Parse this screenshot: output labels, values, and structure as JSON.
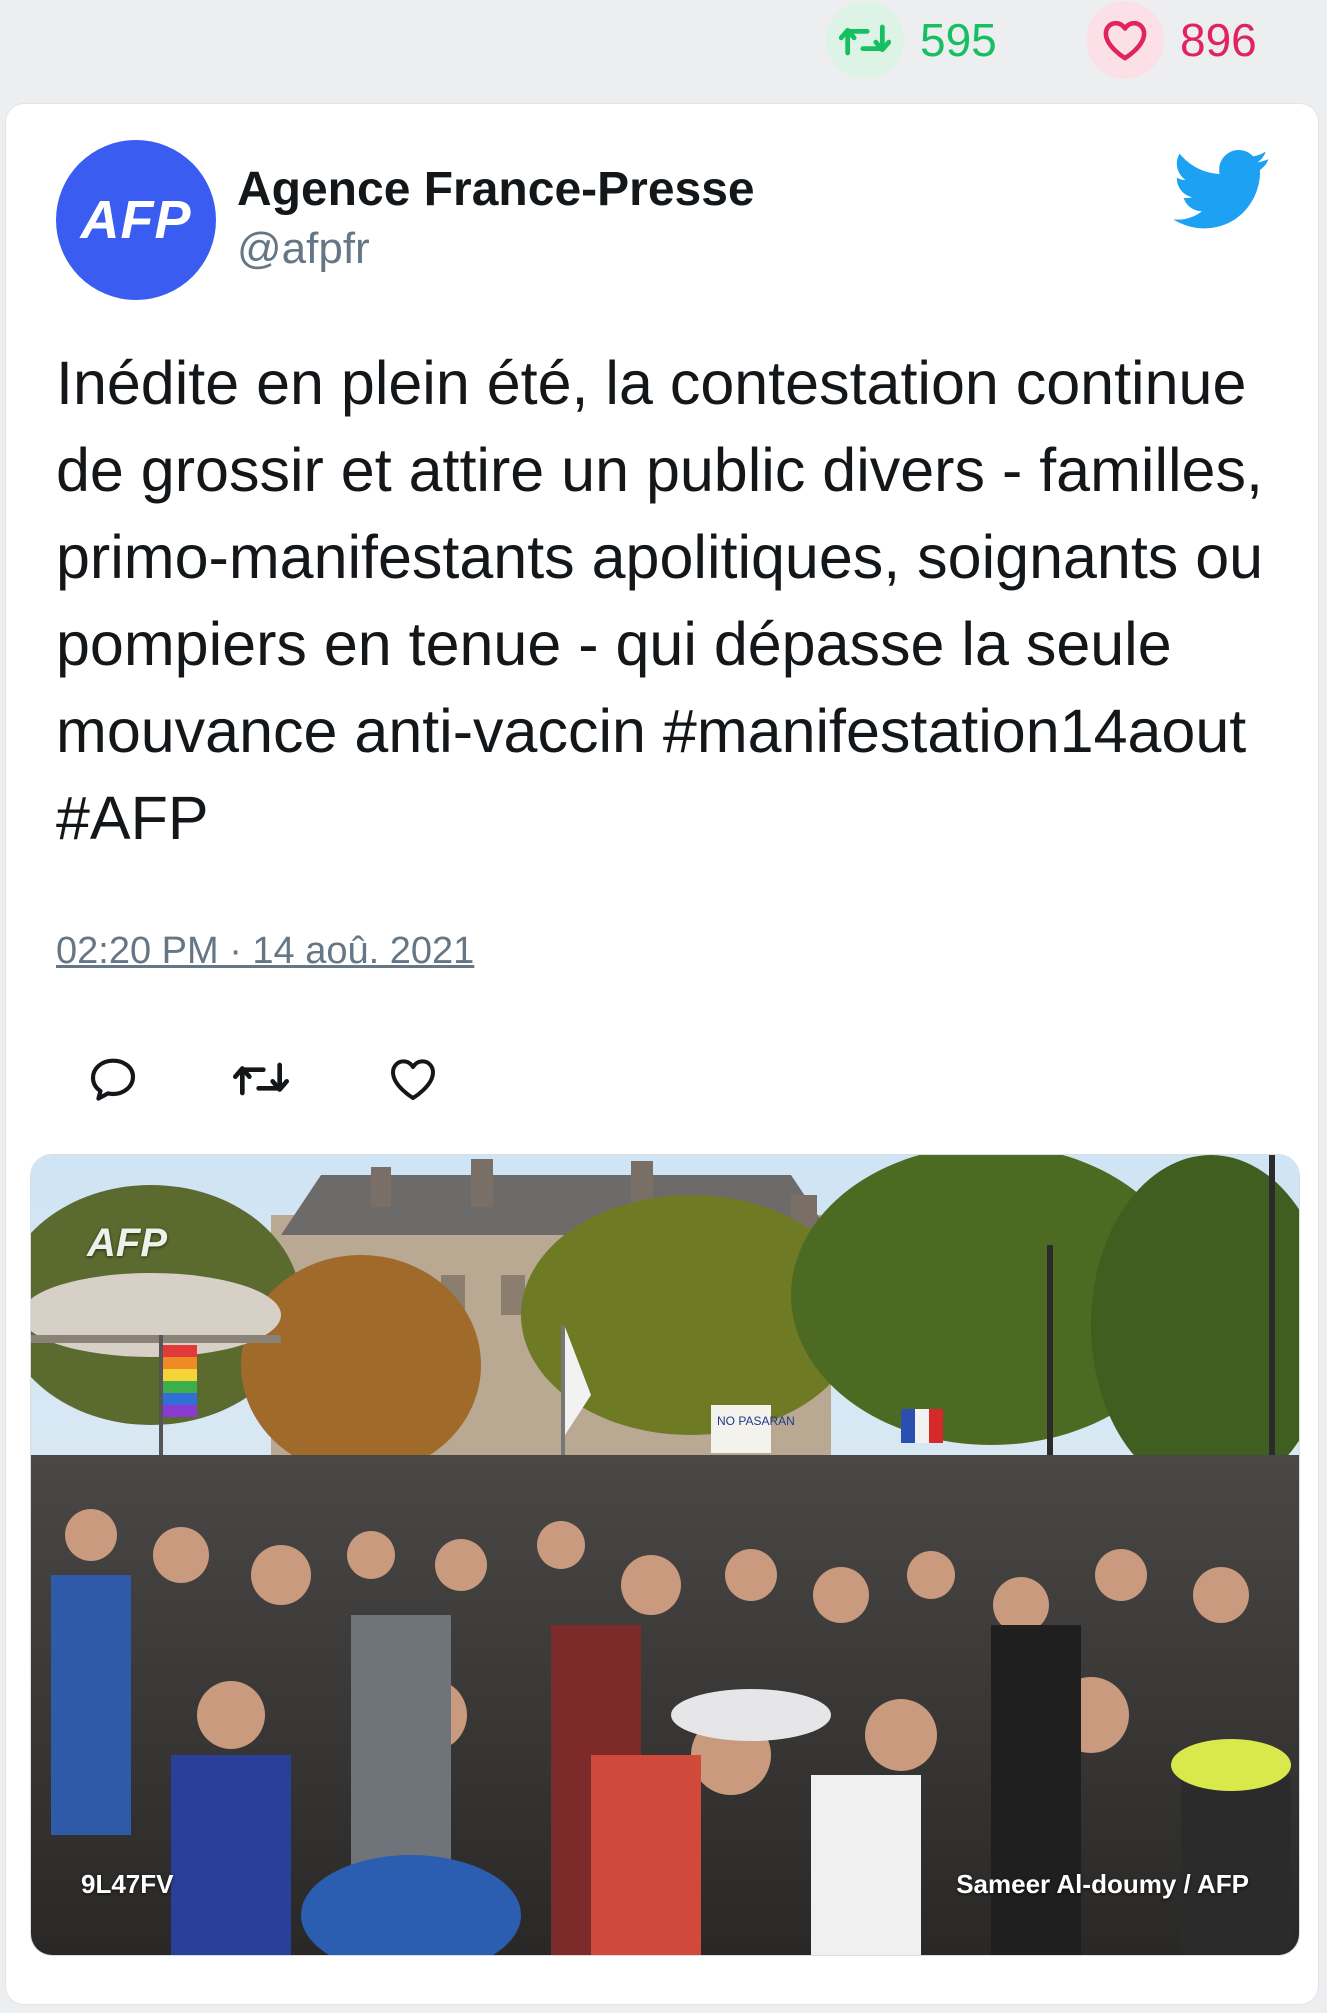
{
  "stats": {
    "retweets": "595",
    "likes": "896",
    "retweet_icon": "retweet-icon",
    "like_icon": "heart-icon"
  },
  "tweet": {
    "author_name": "Agence France-Presse",
    "handle": "@afpfr",
    "avatar_text": "AFP",
    "text": "Inédite en plein été, la contestation continue de grossir et attire un public divers - familles, primo-manifestants apolitiques, soignants ou pompiers en tenue - qui dépasse la seule mouvance anti-vaccin #manifestation14aout #AFP",
    "timestamp": "02:20 PM · 14 aoû. 2021",
    "platform_icon": "twitter-bird-icon"
  },
  "actions": [
    "reply-icon",
    "retweet-icon",
    "heart-icon"
  ],
  "media": {
    "watermark": "AFP",
    "code": "9L47FV",
    "credit": "Sameer Al-doumy / AFP",
    "sign_text": "NO PASARAN"
  },
  "colors": {
    "retweet": "#17bf63",
    "like": "#e0245e",
    "twitter_blue": "#1da1f2",
    "avatar": "#3b5cf0",
    "secondary_text": "#657786"
  }
}
